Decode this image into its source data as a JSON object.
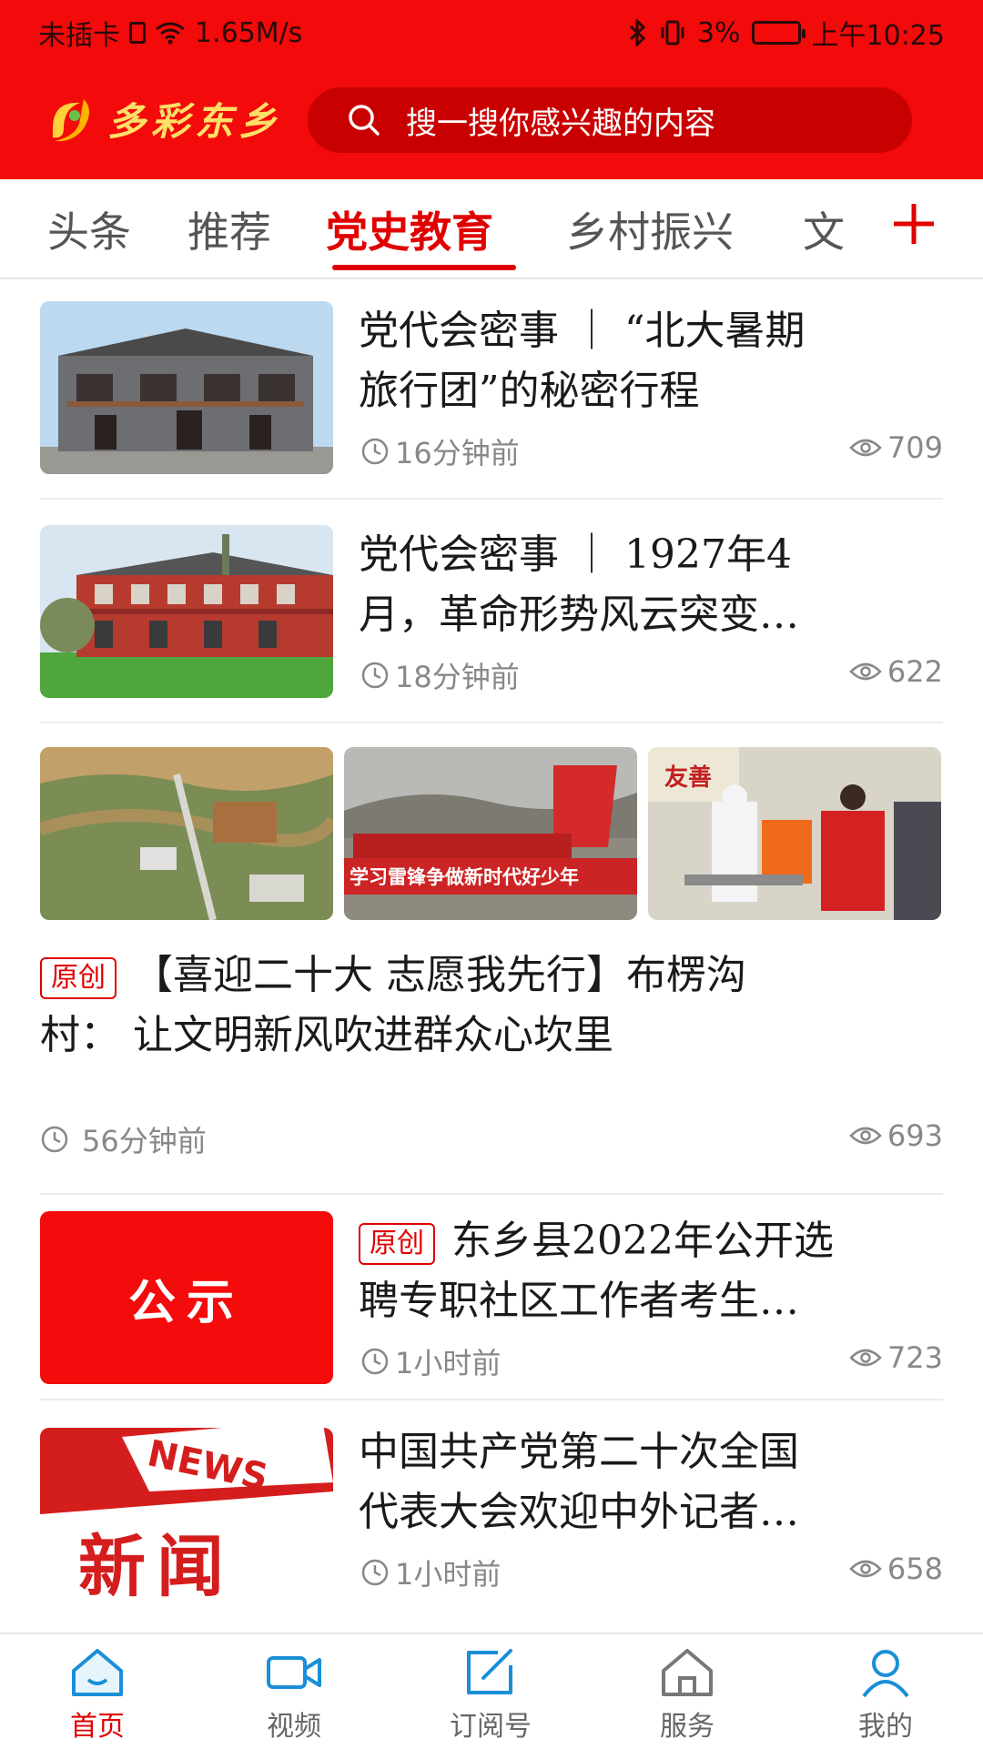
{
  "status_bar": {
    "sim": "未插卡",
    "speed": "1.65M/s",
    "battery": "3%",
    "time": "上午10:25"
  },
  "header": {
    "app_name": "多彩东乡",
    "search_placeholder": "搜一搜你感兴趣的内容"
  },
  "tabs": [
    {
      "label": "头条"
    },
    {
      "label": "推荐"
    },
    {
      "label": "党史教育"
    },
    {
      "label": "乡村振兴"
    },
    {
      "label": "文"
    }
  ],
  "articles": [
    {
      "title_line1": "党代会密事 ｜ “北大暑期",
      "title_line2": "旅行团”的秘密行程",
      "time": "16分钟前",
      "views": "709"
    },
    {
      "title_line1": "党代会密事 ｜ 1927年4",
      "title_line2": "月，革命形势风云突变…",
      "time": "18分钟前",
      "views": "622"
    },
    {
      "badge": "原创",
      "title_line1": "【喜迎二十大  志愿我先行】布楞沟",
      "title_line2": "村：  让文明新风吹进群众心坎里",
      "time": "56分钟前",
      "views": "693",
      "image2_caption": "学习雷锋争做新时代好少年",
      "image3_sign": "友善"
    },
    {
      "badge": "原创",
      "title_line1": "东乡县2022年公开选",
      "title_line2": "聘专职社区工作者考生…",
      "time": "1小时前",
      "views": "723",
      "thumb_text": "公示"
    },
    {
      "title_line1": "中国共产党第二十次全国",
      "title_line2": "代表大会欢迎中外记者…",
      "time": "1小时前",
      "views": "658",
      "thumb_top": "NEWS",
      "thumb_text": "新闻"
    }
  ],
  "bottom_nav": [
    {
      "label": "首页"
    },
    {
      "label": "视频"
    },
    {
      "label": "订阅号"
    },
    {
      "label": "服务"
    },
    {
      "label": "我的"
    }
  ],
  "colors": {
    "brand_red": "#f30a0a",
    "accent": "#e00000"
  }
}
